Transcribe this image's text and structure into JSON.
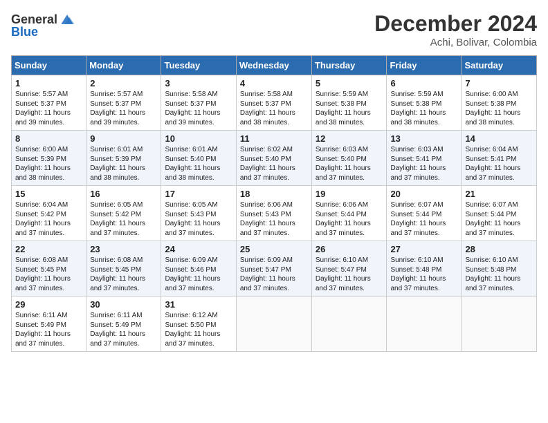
{
  "header": {
    "logo_general": "General",
    "logo_blue": "Blue",
    "month_title": "December 2024",
    "location": "Achi, Bolivar, Colombia"
  },
  "weekdays": [
    "Sunday",
    "Monday",
    "Tuesday",
    "Wednesday",
    "Thursday",
    "Friday",
    "Saturday"
  ],
  "weeks": [
    [
      {
        "day": "1",
        "sunrise": "5:57 AM",
        "sunset": "5:37 PM",
        "daylight": "11 hours and 39 minutes."
      },
      {
        "day": "2",
        "sunrise": "5:57 AM",
        "sunset": "5:37 PM",
        "daylight": "11 hours and 39 minutes."
      },
      {
        "day": "3",
        "sunrise": "5:58 AM",
        "sunset": "5:37 PM",
        "daylight": "11 hours and 39 minutes."
      },
      {
        "day": "4",
        "sunrise": "5:58 AM",
        "sunset": "5:37 PM",
        "daylight": "11 hours and 38 minutes."
      },
      {
        "day": "5",
        "sunrise": "5:59 AM",
        "sunset": "5:38 PM",
        "daylight": "11 hours and 38 minutes."
      },
      {
        "day": "6",
        "sunrise": "5:59 AM",
        "sunset": "5:38 PM",
        "daylight": "11 hours and 38 minutes."
      },
      {
        "day": "7",
        "sunrise": "6:00 AM",
        "sunset": "5:38 PM",
        "daylight": "11 hours and 38 minutes."
      }
    ],
    [
      {
        "day": "8",
        "sunrise": "6:00 AM",
        "sunset": "5:39 PM",
        "daylight": "11 hours and 38 minutes."
      },
      {
        "day": "9",
        "sunrise": "6:01 AM",
        "sunset": "5:39 PM",
        "daylight": "11 hours and 38 minutes."
      },
      {
        "day": "10",
        "sunrise": "6:01 AM",
        "sunset": "5:40 PM",
        "daylight": "11 hours and 38 minutes."
      },
      {
        "day": "11",
        "sunrise": "6:02 AM",
        "sunset": "5:40 PM",
        "daylight": "11 hours and 37 minutes."
      },
      {
        "day": "12",
        "sunrise": "6:03 AM",
        "sunset": "5:40 PM",
        "daylight": "11 hours and 37 minutes."
      },
      {
        "day": "13",
        "sunrise": "6:03 AM",
        "sunset": "5:41 PM",
        "daylight": "11 hours and 37 minutes."
      },
      {
        "day": "14",
        "sunrise": "6:04 AM",
        "sunset": "5:41 PM",
        "daylight": "11 hours and 37 minutes."
      }
    ],
    [
      {
        "day": "15",
        "sunrise": "6:04 AM",
        "sunset": "5:42 PM",
        "daylight": "11 hours and 37 minutes."
      },
      {
        "day": "16",
        "sunrise": "6:05 AM",
        "sunset": "5:42 PM",
        "daylight": "11 hours and 37 minutes."
      },
      {
        "day": "17",
        "sunrise": "6:05 AM",
        "sunset": "5:43 PM",
        "daylight": "11 hours and 37 minutes."
      },
      {
        "day": "18",
        "sunrise": "6:06 AM",
        "sunset": "5:43 PM",
        "daylight": "11 hours and 37 minutes."
      },
      {
        "day": "19",
        "sunrise": "6:06 AM",
        "sunset": "5:44 PM",
        "daylight": "11 hours and 37 minutes."
      },
      {
        "day": "20",
        "sunrise": "6:07 AM",
        "sunset": "5:44 PM",
        "daylight": "11 hours and 37 minutes."
      },
      {
        "day": "21",
        "sunrise": "6:07 AM",
        "sunset": "5:44 PM",
        "daylight": "11 hours and 37 minutes."
      }
    ],
    [
      {
        "day": "22",
        "sunrise": "6:08 AM",
        "sunset": "5:45 PM",
        "daylight": "11 hours and 37 minutes."
      },
      {
        "day": "23",
        "sunrise": "6:08 AM",
        "sunset": "5:45 PM",
        "daylight": "11 hours and 37 minutes."
      },
      {
        "day": "24",
        "sunrise": "6:09 AM",
        "sunset": "5:46 PM",
        "daylight": "11 hours and 37 minutes."
      },
      {
        "day": "25",
        "sunrise": "6:09 AM",
        "sunset": "5:47 PM",
        "daylight": "11 hours and 37 minutes."
      },
      {
        "day": "26",
        "sunrise": "6:10 AM",
        "sunset": "5:47 PM",
        "daylight": "11 hours and 37 minutes."
      },
      {
        "day": "27",
        "sunrise": "6:10 AM",
        "sunset": "5:48 PM",
        "daylight": "11 hours and 37 minutes."
      },
      {
        "day": "28",
        "sunrise": "6:10 AM",
        "sunset": "5:48 PM",
        "daylight": "11 hours and 37 minutes."
      }
    ],
    [
      {
        "day": "29",
        "sunrise": "6:11 AM",
        "sunset": "5:49 PM",
        "daylight": "11 hours and 37 minutes."
      },
      {
        "day": "30",
        "sunrise": "6:11 AM",
        "sunset": "5:49 PM",
        "daylight": "11 hours and 37 minutes."
      },
      {
        "day": "31",
        "sunrise": "6:12 AM",
        "sunset": "5:50 PM",
        "daylight": "11 hours and 37 minutes."
      },
      null,
      null,
      null,
      null
    ]
  ]
}
